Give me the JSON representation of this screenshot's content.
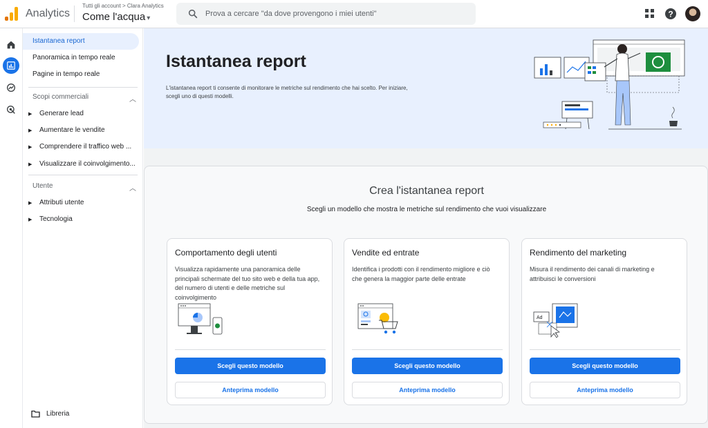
{
  "header": {
    "app_name": "Analytics",
    "breadcrumb": "Tutti gli account > Clara Analytics",
    "property": "Come l'acqua",
    "search_placeholder": "Prova a cercare \"da dove provengono i miei utenti\""
  },
  "sidebar": {
    "items": [
      {
        "label": "Istantanea report"
      },
      {
        "label": "Panoramica in tempo reale"
      },
      {
        "label": "Pagine in tempo reale"
      }
    ],
    "sections": [
      {
        "title": "Scopi commerciali",
        "items": [
          {
            "label": "Generare lead"
          },
          {
            "label": "Aumentare le vendite"
          },
          {
            "label": "Comprendere il traffico web ..."
          },
          {
            "label": "Visualizzare il coinvolgimento..."
          }
        ]
      },
      {
        "title": "Utente",
        "items": [
          {
            "label": "Attributi utente"
          },
          {
            "label": "Tecnologia"
          }
        ]
      }
    ],
    "library": "Libreria"
  },
  "hero": {
    "title": "Istantanea report",
    "description": "L'istantanea report ti consente di monitorare le metriche sul rendimento che hai scelto. Per iniziare, scegli uno di questi modelli."
  },
  "panel": {
    "title": "Crea l'istantanea report",
    "subtitle": "Scegli un modello che mostra le metriche sul rendimento che vuoi visualizzare"
  },
  "cards": [
    {
      "title": "Comportamento degli utenti",
      "description": "Visualizza rapidamente una panoramica delle principali schermate del tuo sito web e della tua app, del numero di utenti e delle metriche sul coinvolgimento",
      "primary": "Scegli questo modello",
      "secondary": "Anteprima modello"
    },
    {
      "title": "Vendite ed entrate",
      "description": "Identifica i prodotti con il rendimento migliore e ciò che genera la maggior parte delle entrate",
      "primary": "Scegli questo modello",
      "secondary": "Anteprima modello"
    },
    {
      "title": "Rendimento del marketing",
      "description": "Misura il rendimento dei canali di marketing e attribuisci le conversioni",
      "primary": "Scegli questo modello",
      "secondary": "Anteprima modello"
    }
  ],
  "illustration_labels": {
    "ad_label": "Ad"
  },
  "colors": {
    "primary": "#1a73e8",
    "hero_bg": "#e8f0fe",
    "active_text": "#1967d2",
    "logo_orange": "#f9ab00",
    "logo_dark_orange": "#e37400",
    "accent_green": "#1e8e3e"
  },
  "icons": {
    "top": [
      "search-icon",
      "apps-grid-icon",
      "help-icon"
    ],
    "rail": [
      "home-icon",
      "reports-icon",
      "explore-icon",
      "advertising-icon"
    ],
    "library": "folder-icon"
  }
}
